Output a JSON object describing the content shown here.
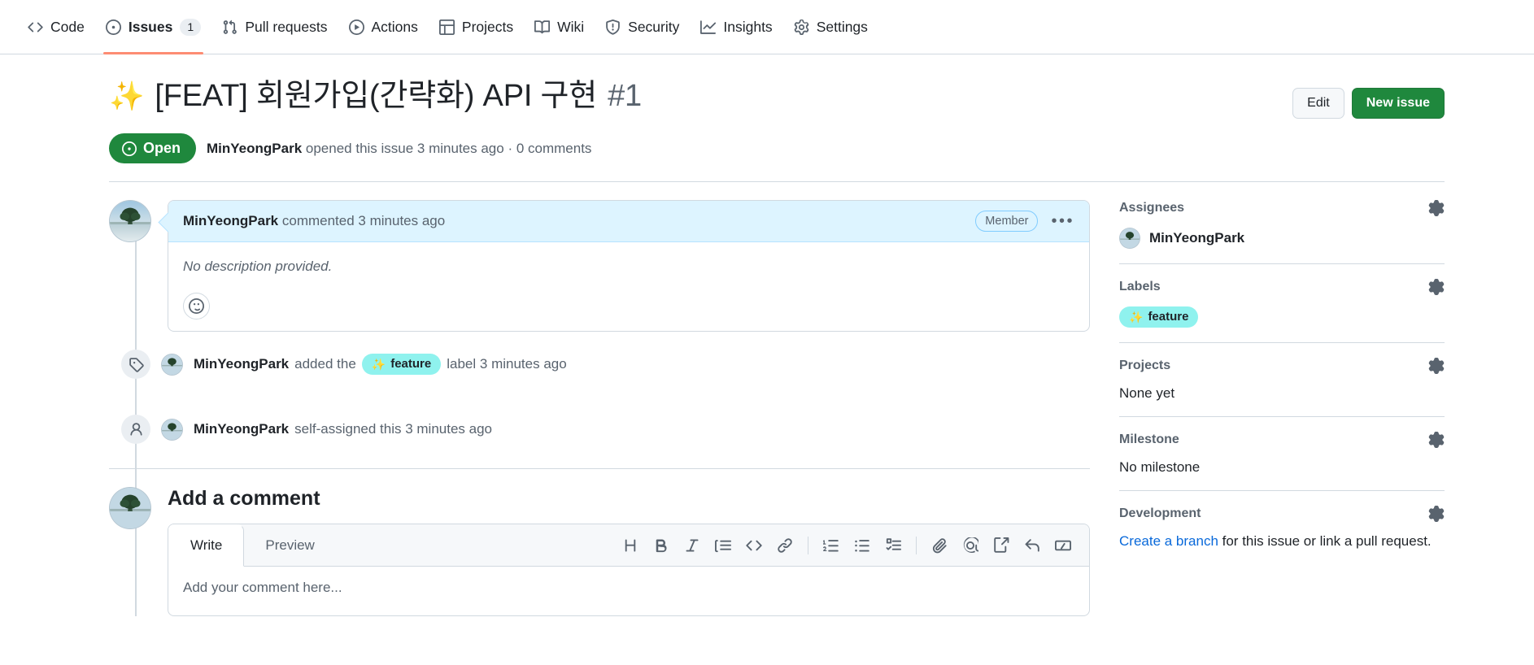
{
  "repo_nav": {
    "items": [
      {
        "label": "Code",
        "icon": "code-icon",
        "active": false,
        "count": null
      },
      {
        "label": "Issues",
        "icon": "issue-opened-icon",
        "active": true,
        "count": "1"
      },
      {
        "label": "Pull requests",
        "icon": "git-pull-request-icon",
        "active": false,
        "count": null
      },
      {
        "label": "Actions",
        "icon": "play-icon",
        "active": false,
        "count": null
      },
      {
        "label": "Projects",
        "icon": "table-icon",
        "active": false,
        "count": null
      },
      {
        "label": "Wiki",
        "icon": "book-icon",
        "active": false,
        "count": null
      },
      {
        "label": "Security",
        "icon": "shield-icon",
        "active": false,
        "count": null
      },
      {
        "label": "Insights",
        "icon": "graph-icon",
        "active": false,
        "count": null
      },
      {
        "label": "Settings",
        "icon": "gear-icon",
        "active": false,
        "count": null
      }
    ]
  },
  "issue": {
    "emoji": "✨",
    "title": "[FEAT] 회원가입(간략화) API 구현",
    "number": "#1",
    "edit_label": "Edit",
    "new_issue_label": "New issue",
    "state": "Open",
    "state_color": "#1f883d",
    "meta_author": "MinYeongPark",
    "meta_rest": "opened this issue 3 minutes ago · 0 comments"
  },
  "comment": {
    "author": "MinYeongPark",
    "meta": "commented 3 minutes ago",
    "role_badge": "Member",
    "menu_icon": "kebab-horizontal-icon",
    "body": "No description provided.",
    "reaction_icon": "smiley-icon"
  },
  "timeline": [
    {
      "icon": "tag-icon",
      "actor": "MinYeongPark",
      "action_before": "added the",
      "label": "feature",
      "label_emoji": "✨",
      "label_color": "#8ff2ee",
      "action_after": "label 3 minutes ago"
    },
    {
      "icon": "person-icon",
      "actor": "MinYeongPark",
      "action_before": "self-assigned this 3 minutes ago",
      "label": null,
      "label_emoji": null,
      "label_color": null,
      "action_after": ""
    }
  ],
  "add_comment": {
    "heading": "Add a comment",
    "tabs": [
      {
        "label": "Write",
        "active": true
      },
      {
        "label": "Preview",
        "active": false
      }
    ],
    "placeholder": "Add your comment here...",
    "toolbar": [
      {
        "name": "heading-icon",
        "title": "Heading"
      },
      {
        "name": "bold-icon",
        "title": "Bold"
      },
      {
        "name": "italic-icon",
        "title": "Italic"
      },
      {
        "name": "quote-icon",
        "title": "Quote"
      },
      {
        "name": "code-icon",
        "title": "Code"
      },
      {
        "name": "link-icon",
        "title": "Link"
      },
      {
        "name": "separator",
        "title": ""
      },
      {
        "name": "ordered-list-icon",
        "title": "Numbered list"
      },
      {
        "name": "unordered-list-icon",
        "title": "Unordered list"
      },
      {
        "name": "task-list-icon",
        "title": "Task list"
      },
      {
        "name": "separator",
        "title": ""
      },
      {
        "name": "paperclip-icon",
        "title": "Attach files"
      },
      {
        "name": "mention-icon",
        "title": "Mention"
      },
      {
        "name": "cross-reference-icon",
        "title": "Reference"
      },
      {
        "name": "reply-icon",
        "title": "Saved reply"
      },
      {
        "name": "slash-command-icon",
        "title": "Slash commands"
      }
    ]
  },
  "sidebar": {
    "assignees": {
      "title": "Assignees",
      "value": "MinYeongPark"
    },
    "labels": {
      "title": "Labels",
      "chip": "feature",
      "chip_emoji": "✨",
      "chip_color": "#8ff2ee"
    },
    "projects": {
      "title": "Projects",
      "value": "None yet"
    },
    "milestone": {
      "title": "Milestone",
      "value": "No milestone"
    },
    "development": {
      "title": "Development",
      "link": "Create a branch",
      "rest": " for this issue or link a pull request.",
      "link_color": "#0969da"
    }
  }
}
